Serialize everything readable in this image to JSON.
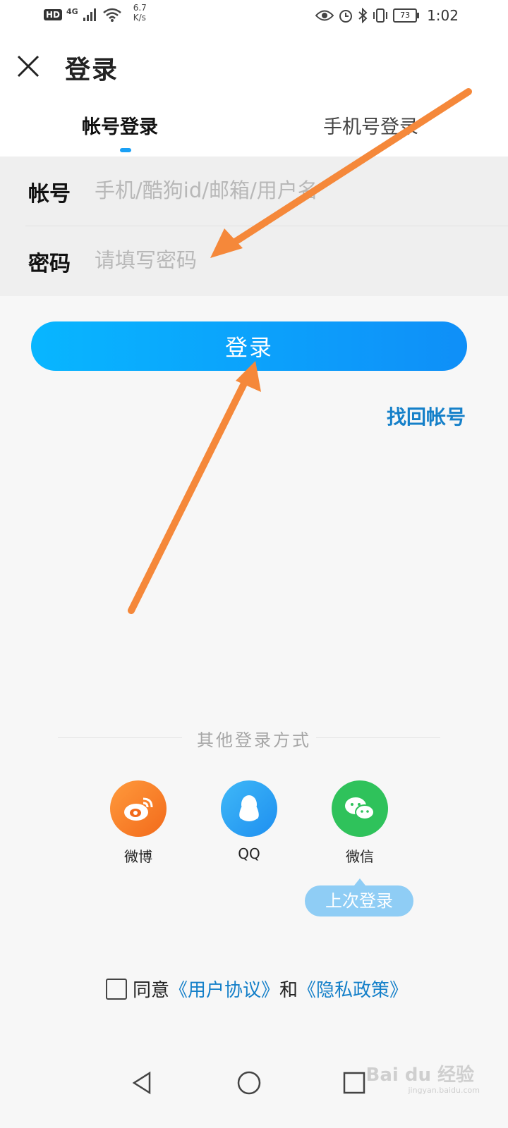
{
  "status_bar": {
    "hd": "HD",
    "network": "4G",
    "speed_value": "6.7",
    "speed_unit": "K/s",
    "battery": "73",
    "time": "1:02"
  },
  "header": {
    "title": "登录",
    "close_icon": "close-icon",
    "tabs": [
      {
        "label": "帐号登录",
        "active": true
      },
      {
        "label": "手机号登录",
        "active": false
      }
    ]
  },
  "form": {
    "account_label": "帐号",
    "account_placeholder": "手机/酷狗id/邮箱/用户名",
    "password_label": "密码",
    "password_placeholder": "请填写密码"
  },
  "login_button": "登录",
  "recover_link": "找回帐号",
  "other_login": {
    "title": "其他登录方式",
    "options": [
      {
        "label": "微博",
        "icon": "weibo-icon",
        "color": "#f77b2b"
      },
      {
        "label": "QQ",
        "icon": "qq-icon",
        "color": "#2aa6f2"
      },
      {
        "label": "微信",
        "icon": "wechat-icon",
        "color": "#2fc25b"
      }
    ],
    "last_login_tip": "上次登录"
  },
  "agreement": {
    "prefix": "同意",
    "user_agreement": "《用户协议》",
    "and": "和",
    "privacy_policy": "《隐私政策》"
  },
  "nav": {
    "back_icon": "back-triangle-icon",
    "home_icon": "home-circle-icon",
    "recent_icon": "recent-square-icon"
  },
  "watermark": {
    "text": "Bai du 经验",
    "sub": "jingyan.baidu.com"
  },
  "colors": {
    "accent": "#0f8ff8",
    "link": "#1580c9",
    "annotation_arrow": "#f5883a"
  }
}
